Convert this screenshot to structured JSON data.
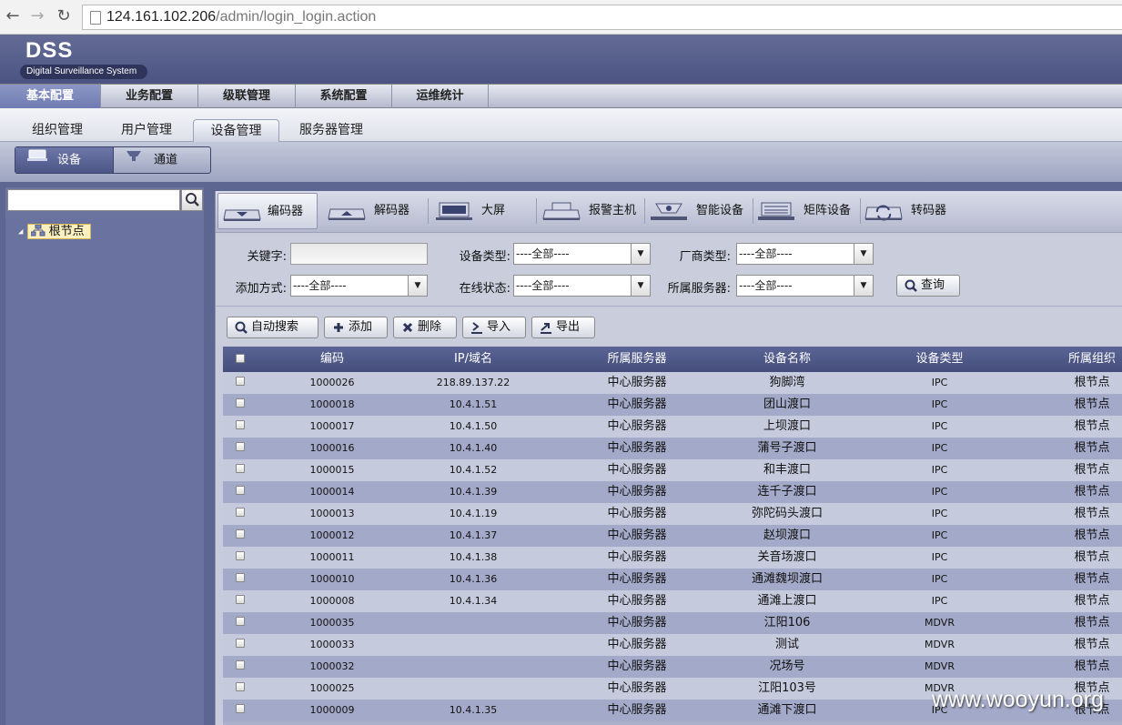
{
  "browser": {
    "url_host": "124.161.102.206",
    "url_path": "/admin/login_login.action"
  },
  "app": {
    "logo_title": "DSS",
    "logo_subtitle": "Digital Surveillance System"
  },
  "main_menu": [
    "基本配置",
    "业务配置",
    "级联管理",
    "系统配置",
    "运维统计"
  ],
  "sub_menu": [
    "组织管理",
    "用户管理",
    "设备管理",
    "服务器管理"
  ],
  "toggles": [
    "设备",
    "通道"
  ],
  "tree": {
    "root": "根节点"
  },
  "device_types": [
    "编码器",
    "解码器",
    "大屏",
    "报警主机",
    "智能设备",
    "矩阵设备",
    "转码器"
  ],
  "filters": {
    "keyword_label": "关键字:",
    "device_type_label": "设备类型:",
    "vendor_label": "厂商类型:",
    "add_method_label": "添加方式:",
    "online_label": "在线状态:",
    "server_label": "所属服务器:",
    "all_option": "----全部----",
    "query_button": "查询"
  },
  "toolbar": [
    "自动搜索",
    "添加",
    "删除",
    "导入",
    "导出"
  ],
  "table": {
    "headers": [
      "编码",
      "IP/域名",
      "所属服务器",
      "设备名称",
      "设备类型",
      "所属组织"
    ],
    "rows": [
      [
        "1000026",
        "218.89.137.22",
        "中心服务器",
        "狗脚湾",
        "IPC",
        "根节点"
      ],
      [
        "1000018",
        "10.4.1.51",
        "中心服务器",
        "团山渡口",
        "IPC",
        "根节点"
      ],
      [
        "1000017",
        "10.4.1.50",
        "中心服务器",
        "上坝渡口",
        "IPC",
        "根节点"
      ],
      [
        "1000016",
        "10.4.1.40",
        "中心服务器",
        "蒲号子渡口",
        "IPC",
        "根节点"
      ],
      [
        "1000015",
        "10.4.1.52",
        "中心服务器",
        "和丰渡口",
        "IPC",
        "根节点"
      ],
      [
        "1000014",
        "10.4.1.39",
        "中心服务器",
        "连千子渡口",
        "IPC",
        "根节点"
      ],
      [
        "1000013",
        "10.4.1.19",
        "中心服务器",
        "弥陀码头渡口",
        "IPC",
        "根节点"
      ],
      [
        "1000012",
        "10.4.1.37",
        "中心服务器",
        "赵坝渡口",
        "IPC",
        "根节点"
      ],
      [
        "1000011",
        "10.4.1.38",
        "中心服务器",
        "关音场渡口",
        "IPC",
        "根节点"
      ],
      [
        "1000010",
        "10.4.1.36",
        "中心服务器",
        "通滩魏坝渡口",
        "IPC",
        "根节点"
      ],
      [
        "1000008",
        "10.4.1.34",
        "中心服务器",
        "通滩上渡口",
        "IPC",
        "根节点"
      ],
      [
        "1000035",
        "",
        "中心服务器",
        "江阳106",
        "MDVR",
        "根节点"
      ],
      [
        "1000033",
        "",
        "中心服务器",
        "测试",
        "MDVR",
        "根节点"
      ],
      [
        "1000032",
        "",
        "中心服务器",
        "况场号",
        "MDVR",
        "根节点"
      ],
      [
        "1000025",
        "",
        "中心服务器",
        "江阳103号",
        "MDVR",
        "根节点"
      ],
      [
        "1000009",
        "10.4.1.35",
        "中心服务器",
        "通滩下渡口",
        "IPC",
        "根节点"
      ]
    ]
  },
  "watermark": "www.wooyun.org"
}
